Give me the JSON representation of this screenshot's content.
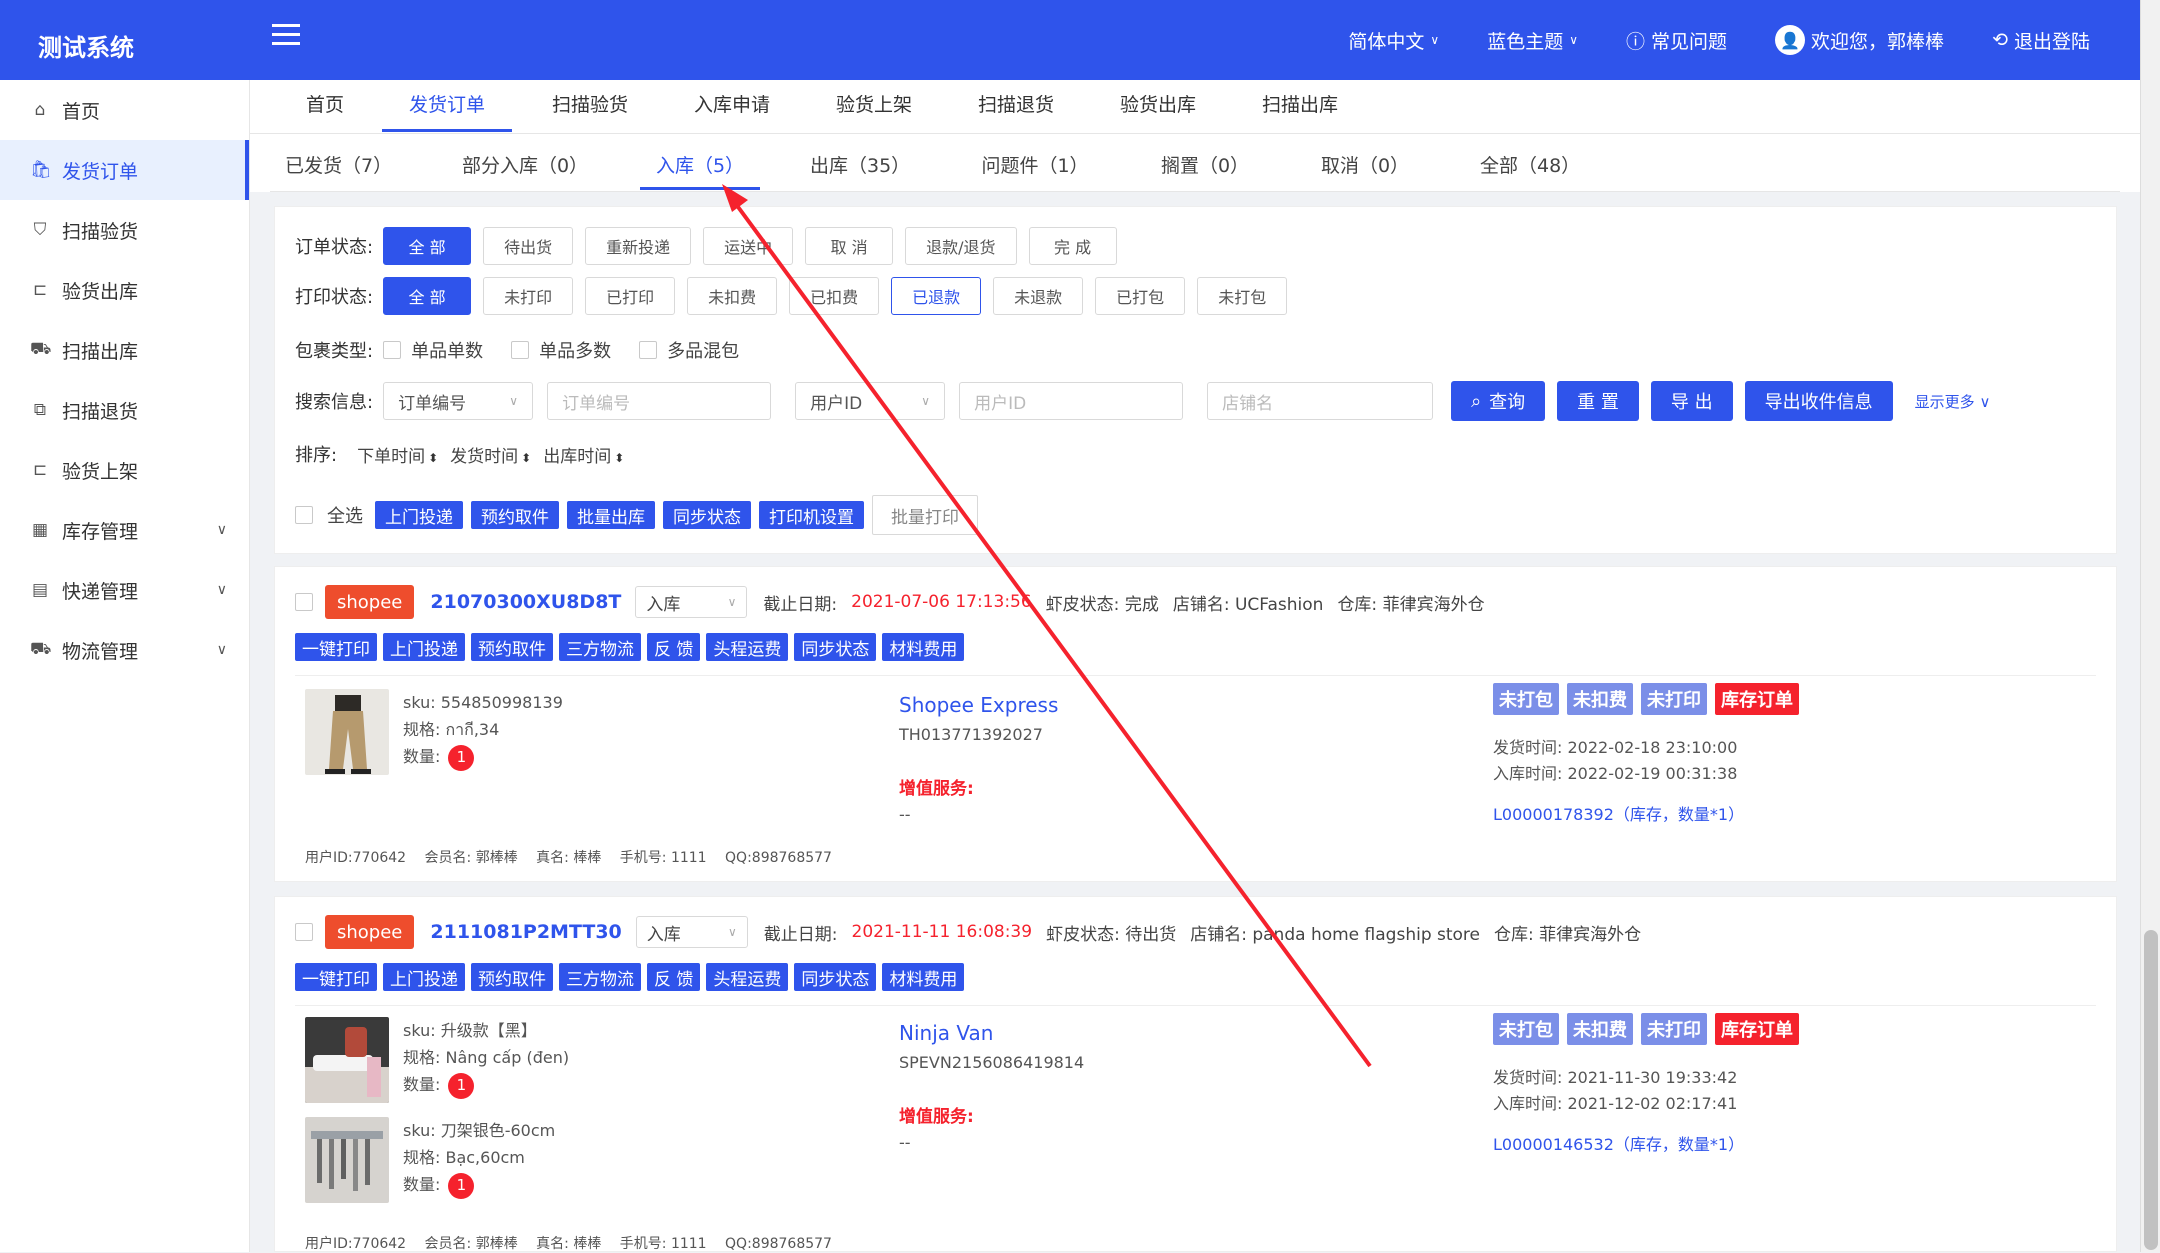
{
  "header": {
    "logo": "测试系统",
    "lang": "简体中文",
    "theme": "蓝色主题",
    "faq": "常见问题",
    "welcome": "欢迎您，郭棒棒",
    "logout": "退出登陆"
  },
  "sidebar": {
    "items": [
      {
        "label": "首页",
        "icon": "home-icon"
      },
      {
        "label": "发货订单",
        "icon": "bag-icon"
      },
      {
        "label": "扫描验货",
        "icon": "shield-icon"
      },
      {
        "label": "验货出库",
        "icon": "scan-icon"
      },
      {
        "label": "扫描出库",
        "icon": "truck-icon"
      },
      {
        "label": "扫描退货",
        "icon": "return-icon"
      },
      {
        "label": "验货上架",
        "icon": "scan-icon"
      },
      {
        "label": "库存管理",
        "icon": "grid-icon"
      },
      {
        "label": "快递管理",
        "icon": "list-icon"
      },
      {
        "label": "物流管理",
        "icon": "truck-icon"
      }
    ]
  },
  "topnav": {
    "tabs": [
      "首页",
      "发货订单",
      "扫描验货",
      "入库申请",
      "验货上架",
      "扫描退货",
      "验货出库",
      "扫描出库"
    ]
  },
  "subtabs": {
    "tabs": [
      "已发货（7）",
      "部分入库（0）",
      "入库（5）",
      "出库（35）",
      "问题件（1）",
      "搁置（0）",
      "取消（0）",
      "全部（48）"
    ]
  },
  "filter": {
    "order_status_label": "订单状态:",
    "order_status": [
      "全 部",
      "待出货",
      "重新投递",
      "运送中",
      "取 消",
      "退款/退货",
      "完 成"
    ],
    "print_status_label": "打印状态:",
    "print_status": [
      "全 部",
      "未打印",
      "已打印",
      "未扣费",
      "已扣费",
      "已退款",
      "未退款",
      "已打包",
      "未打包"
    ],
    "package_label": "包裹类型:",
    "package_types": [
      "单品单数",
      "单品多数",
      "多品混包"
    ],
    "search_label": "搜索信息:",
    "search_select1": "订单编号",
    "search_input1": "订单编号",
    "search_select2": "用户ID",
    "search_input2": "用户ID",
    "search_input3": "店铺名",
    "btn_query": "查询",
    "btn_reset": "重 置",
    "btn_export": "导 出",
    "btn_export_recv": "导出收件信息",
    "show_more": "显示更多",
    "sort_label": "排序:",
    "sort_items": [
      "下单时间",
      "发货时间",
      "出库时间"
    ],
    "select_all": "全选",
    "batch_buttons": [
      "上门投递",
      "预约取件",
      "批量出库",
      "同步状态",
      "打印机设置"
    ],
    "batch_print": "批量打印"
  },
  "action_buttons": [
    "一键打印",
    "上门投递",
    "预约取件",
    "三方物流",
    "反 馈",
    "头程运费",
    "同步状态",
    "材料费用"
  ],
  "orders": [
    {
      "shop": "shopee",
      "order_no": "21070300XU8D8T",
      "status_select": "入库",
      "deadline_label": "截止日期:",
      "deadline": "2021-07-06 17:13:56",
      "shrimp_status": "虾皮状态: 完成",
      "store": "店铺名: UCFashion",
      "warehouse": "仓库: 菲律宾海外仓",
      "items": [
        {
          "sku": "sku: 554850998139",
          "spec": "规格: กากี,34",
          "qty_label": "数量:",
          "qty": "1"
        }
      ],
      "carrier": "Shopee Express",
      "tracking": "TH013771392027",
      "vas_label": "增值服务:",
      "vas": "--",
      "badges": [
        "未打包",
        "未扣费",
        "未打印",
        "库存订单"
      ],
      "ship_time": "发货时间: 2022-02-18 23:10:00",
      "in_time": "入库时间: 2022-02-19 00:31:38",
      "lot": "L00000178392（库存，数量*1）",
      "footer": [
        "用户ID:770642",
        "会员名: 郭棒棒",
        "真名: 棒棒",
        "手机号: 1111",
        "QQ:898768577"
      ]
    },
    {
      "shop": "shopee",
      "order_no": "2111081P2MTT30",
      "status_select": "入库",
      "deadline_label": "截止日期:",
      "deadline": "2021-11-11 16:08:39",
      "shrimp_status": "虾皮状态: 待出货",
      "store": "店铺名: panda home flagship store",
      "warehouse": "仓库: 菲律宾海外仓",
      "items": [
        {
          "sku": "sku: 升级款【黑】",
          "spec": "规格: Nâng cấp (đen)",
          "qty_label": "数量:",
          "qty": "1"
        },
        {
          "sku": "sku: 刀架银色-60cm",
          "spec": "规格: Bạc,60cm",
          "qty_label": "数量:",
          "qty": "1"
        }
      ],
      "carrier": "Ninja Van",
      "tracking": "SPEVN2156086419814",
      "vas_label": "增值服务:",
      "vas": "--",
      "badges": [
        "未打包",
        "未扣费",
        "未打印",
        "库存订单"
      ],
      "ship_time": "发货时间: 2021-11-30 19:33:42",
      "in_time": "入库时间: 2021-12-02 02:17:41",
      "lot": "L00000146532（库存，数量*1）",
      "footer": [
        "用户ID:770642",
        "会员名: 郭棒棒",
        "真名: 棒棒",
        "手机号: 1111",
        "QQ:898768577"
      ]
    }
  ]
}
